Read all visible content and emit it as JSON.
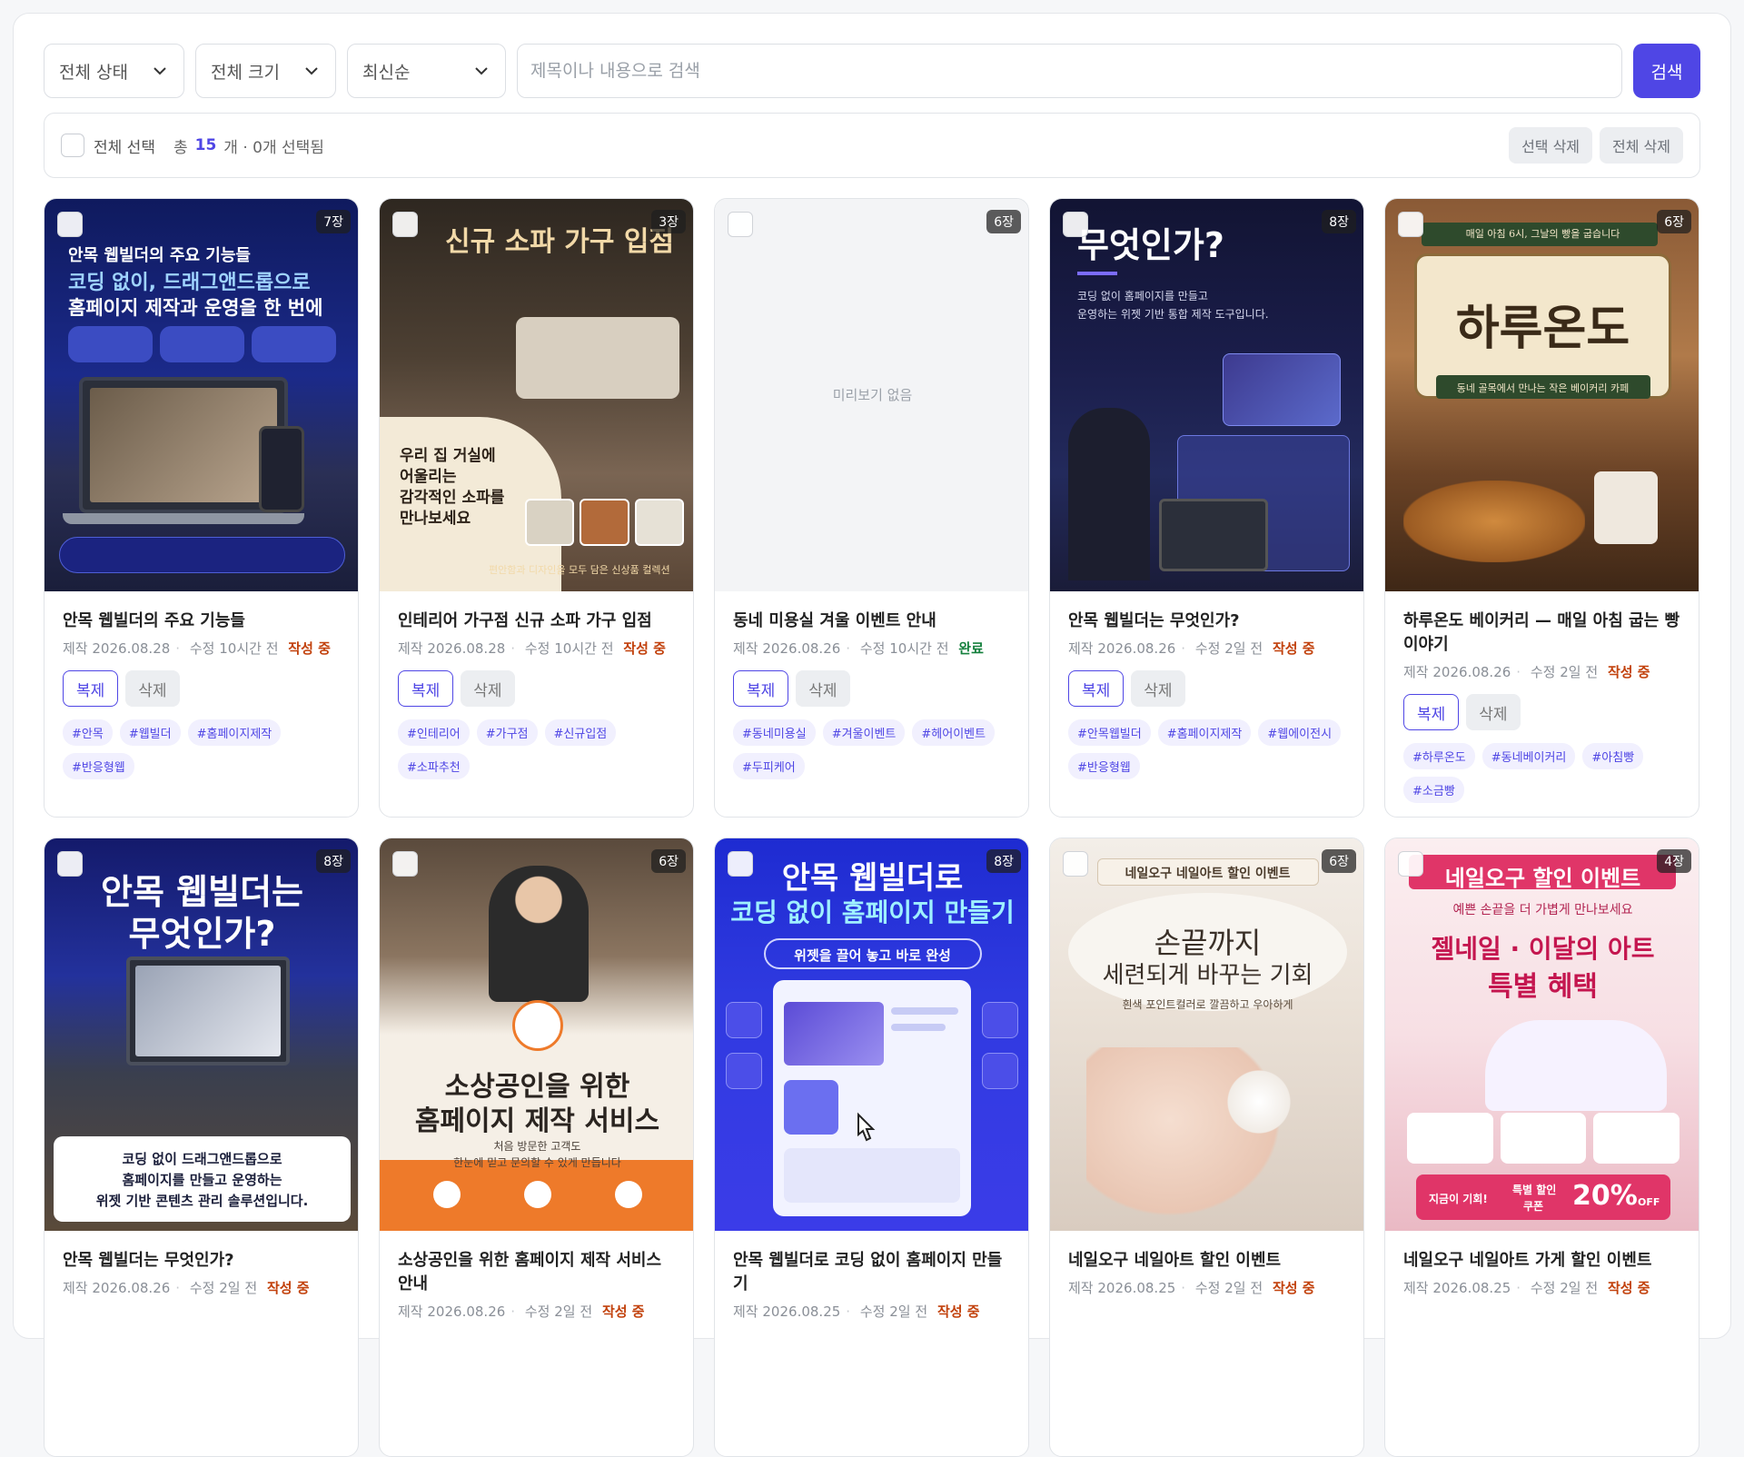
{
  "filters": {
    "status": "전체 상태",
    "size": "전체 크기",
    "sort": "최신순",
    "search_placeholder": "제목이나 내용으로 검색",
    "search_button": "검색"
  },
  "selection": {
    "select_all": "전체 선택",
    "total_prefix": "총",
    "total_count": "15",
    "total_suffix": "개 · 0개 선택됨",
    "delete_selected": "선택 삭제",
    "delete_all": "전체 삭제"
  },
  "labels": {
    "copy": "복제",
    "delete": "삭제",
    "created_prefix": "제작",
    "updated_prefix": "수정",
    "no_preview": "미리보기 없음"
  },
  "colors": {
    "accent": "#4f46e5",
    "status_draft": "#c2410c",
    "status_done": "#15803d"
  },
  "cards": [
    {
      "count": "7장",
      "title": "안목 웹빌더의 주요 기능들",
      "created": "2026.08.28",
      "updated": "10시간 전",
      "status": "작성 중",
      "tags": [
        "#안목",
        "#웹빌더",
        "#홈페이지제작",
        "#반응형웹"
      ],
      "thumb": {
        "heading": "안목 웹빌더의 주요 기능들",
        "line1": "코딩 없이, 드래그앤드롭으로",
        "line2": "홈페이지 제작과 운영을 한 번에"
      }
    },
    {
      "count": "3장",
      "title": "인테리어 가구점 신규 소파 가구 입점",
      "created": "2026.08.28",
      "updated": "10시간 전",
      "status": "작성 중",
      "tags": [
        "#인테리어",
        "#가구점",
        "#신규입점",
        "#소파추천"
      ],
      "thumb": {
        "heading": "신규 소파 가구 입점",
        "line1": "우리 집 거실에",
        "line2": "어울리는",
        "line3": "감각적인 소파를",
        "line4": "만나보세요",
        "footer": "편안함과 디자인을 모두 담은 신상품 컬렉션"
      }
    },
    {
      "count": "6장",
      "title": "동네 미용실 겨울 이벤트 안내",
      "created": "2026.08.26",
      "updated": "10시간 전",
      "status": "완료",
      "tags": [
        "#동네미용실",
        "#겨울이벤트",
        "#헤어이벤트",
        "#두피케어"
      ]
    },
    {
      "count": "8장",
      "title": "안목 웹빌더는 무엇인가?",
      "created": "2026.08.26",
      "updated": "2일 전",
      "status": "작성 중",
      "tags": [
        "#안목웹빌더",
        "#홈페이지제작",
        "#웹에이전시",
        "#반응형웹"
      ],
      "thumb": {
        "heading": "무엇인가?",
        "line1": "코딩 없이 홈페이지를 만들고",
        "line2": "운영하는 위젯 기반 통합 제작 도구입니다."
      }
    },
    {
      "count": "6장",
      "title": "하루온도 베이커리 — 매일 아침 굽는 빵 이야기",
      "created": "2026.08.26",
      "updated": "2일 전",
      "status": "작성 중",
      "tags": [
        "#하루온도",
        "#동네베이커리",
        "#아침빵",
        "#소금빵"
      ],
      "thumb": {
        "banner": "매일 아침 6시, 그날의 빵을 굽습니다",
        "heading": "하루온도",
        "sub": "동네 골목에서 만나는 작은 베이커리 카페"
      }
    },
    {
      "count": "8장",
      "title": "안목 웹빌더는 무엇인가?",
      "created": "2026.08.26",
      "updated": "2일 전",
      "status": "작성 중",
      "thumb": {
        "heading1": "안목 웹빌더는",
        "heading2": "무엇인가?",
        "line1": "코딩 없이 드래그앤드롭으로",
        "line2": "홈페이지를 만들고 운영하는",
        "line3": "위젯 기반 콘텐츠 관리 솔루션입니다."
      }
    },
    {
      "count": "6장",
      "title": "소상공인을 위한 홈페이지 제작 서비스 안내",
      "created": "2026.08.26",
      "updated": "2일 전",
      "status": "작성 중",
      "thumb": {
        "heading1": "소상공인을 위한",
        "heading2": "홈페이지 제작 서비스",
        "line1": "처음 방문한 고객도",
        "line2": "한눈에 믿고 문의할 수 있게 만듭니다"
      }
    },
    {
      "count": "8장",
      "title": "안목 웹빌더로 코딩 없이 홈페이지 만들기",
      "created": "2026.08.25",
      "updated": "2일 전",
      "status": "작성 중",
      "thumb": {
        "heading1": "안목 웹빌더로",
        "heading2": "코딩 없이 홈페이지 만들기",
        "pill": "위젯을 끌어 놓고 바로 완성"
      }
    },
    {
      "count": "6장",
      "title": "네일오구 네일아트 할인 이벤트",
      "created": "2026.08.25",
      "updated": "2일 전",
      "status": "작성 중",
      "thumb": {
        "banner": "네일오구 네일아트 할인 이벤트",
        "heading1": "손끝까지",
        "heading2": "세련되게 바꾸는 기회",
        "sub": "흰색 포인트컬러로 깔끔하고 우아하게"
      }
    },
    {
      "count": "4장",
      "title": "네일오구 네일아트 가게 할인 이벤트",
      "created": "2026.08.25",
      "updated": "2일 전",
      "status": "작성 중",
      "thumb": {
        "banner": "네일오구 할인 이벤트",
        "sub": "예쁜 손끝을 더 가볍게 만나보세요",
        "heading1": "젤네일 · 이달의 아트",
        "heading2": "특별 혜택",
        "cta": "지금이 기회!",
        "coupon1": "특별 할인",
        "coupon2": "쿠폰",
        "discount": "20%",
        "off": "OFF"
      }
    }
  ]
}
